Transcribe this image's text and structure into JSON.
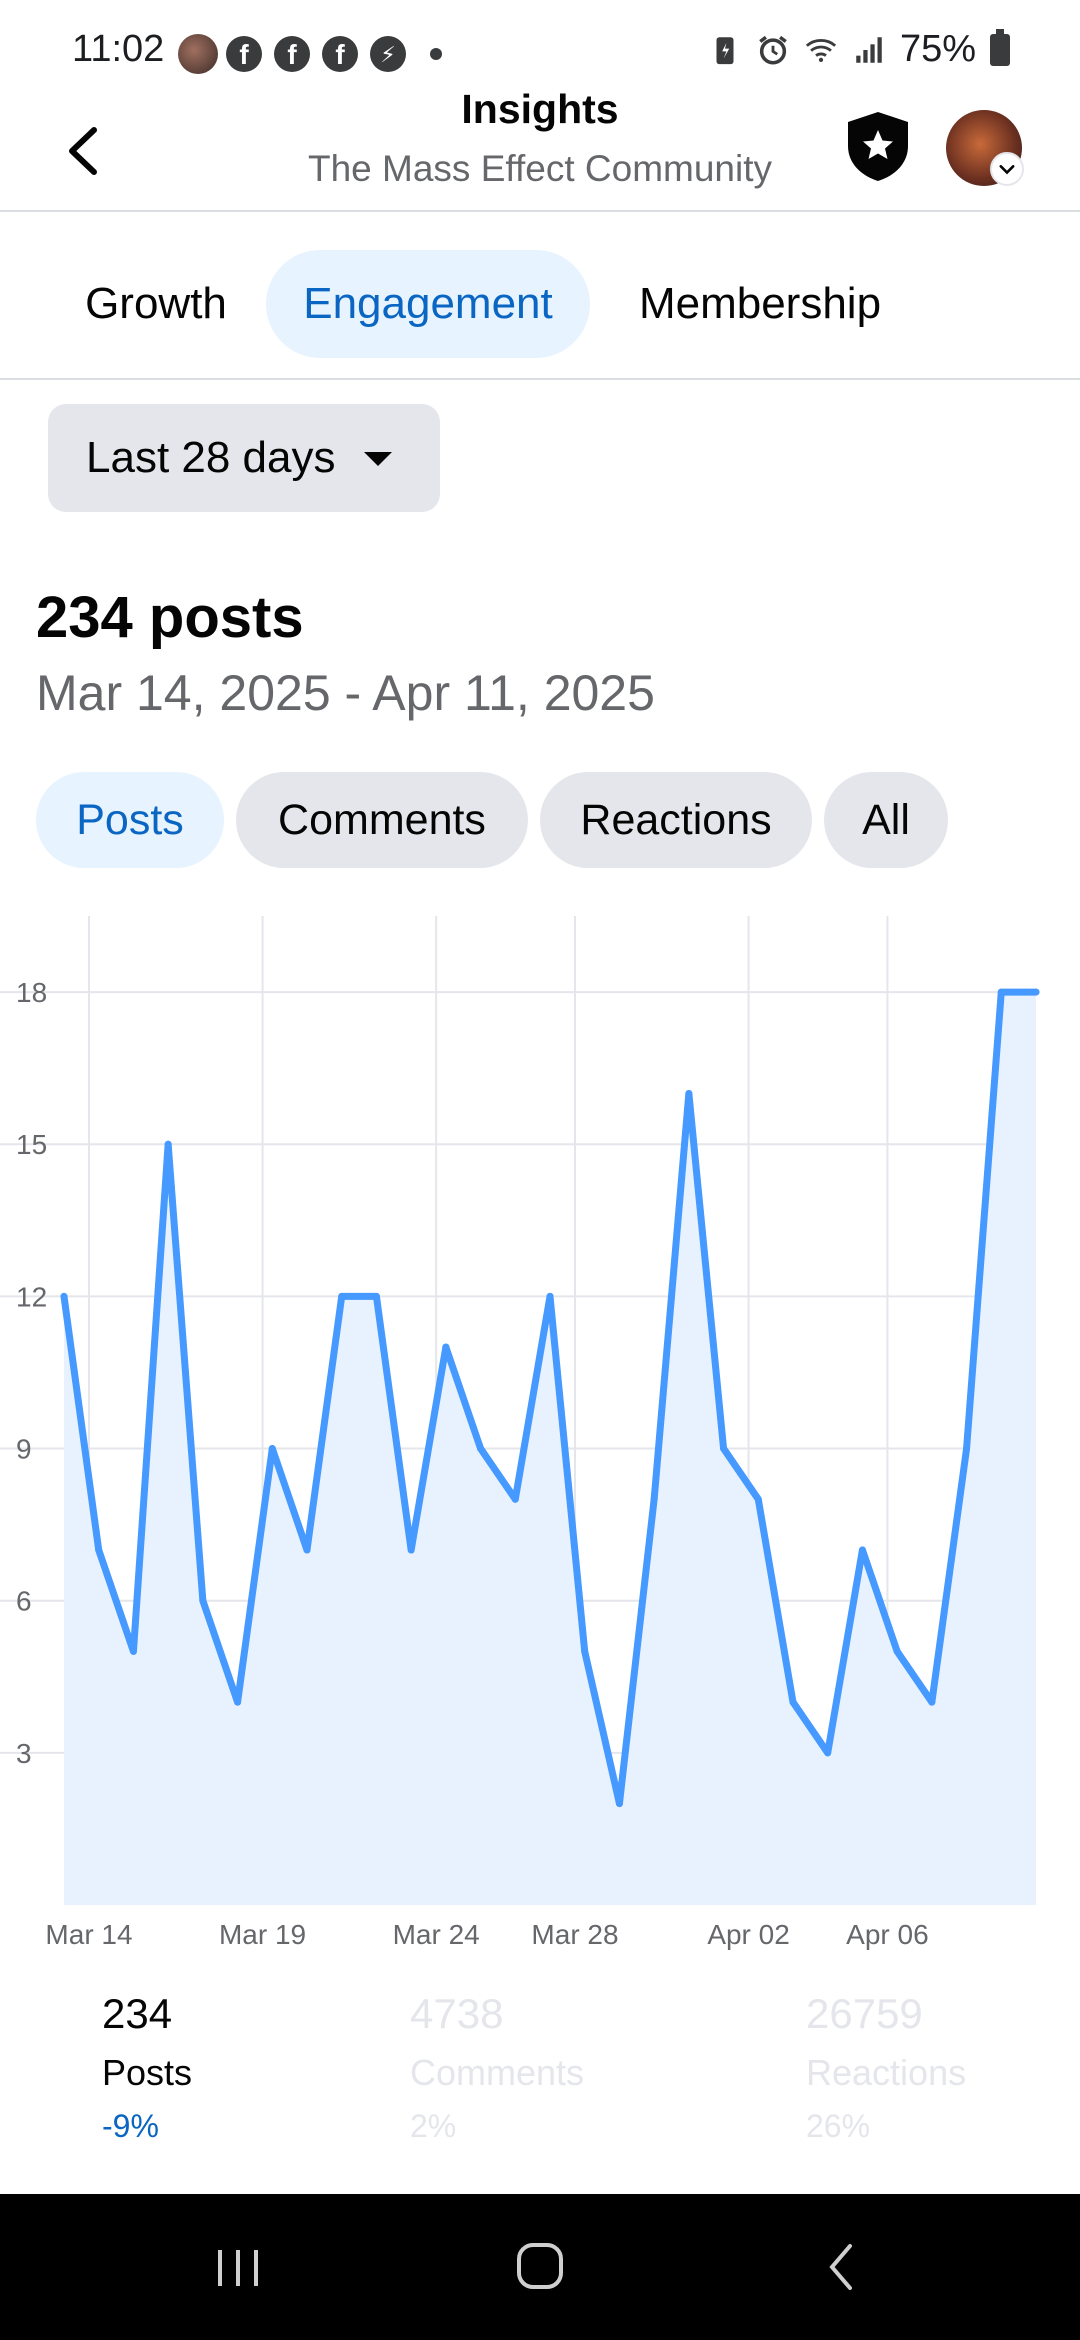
{
  "status_bar": {
    "time": "11:02",
    "battery": "75%",
    "notification_icons": [
      "facebook-icon",
      "facebook-icon",
      "facebook-icon",
      "messenger-icon"
    ]
  },
  "header": {
    "title": "Insights",
    "subtitle": "The Mass Effect Community"
  },
  "tabs": [
    {
      "label": "Growth",
      "active": false
    },
    {
      "label": "Engagement",
      "active": true
    },
    {
      "label": "Membership",
      "active": false
    }
  ],
  "range_selector": {
    "label": "Last 28 days"
  },
  "summary": {
    "title": "234 posts",
    "date_range": "Mar 14, 2025 - Apr 11, 2025"
  },
  "chips": [
    {
      "label": "Posts",
      "active": true
    },
    {
      "label": "Comments",
      "active": false
    },
    {
      "label": "Reactions",
      "active": false
    },
    {
      "label": "All",
      "active": false
    }
  ],
  "chart_data": {
    "type": "area",
    "x": [
      "Mar 14",
      "Mar 15",
      "Mar 16",
      "Mar 17",
      "Mar 18",
      "Mar 19",
      "Mar 20",
      "Mar 21",
      "Mar 22",
      "Mar 23",
      "Mar 24",
      "Mar 25",
      "Mar 26",
      "Mar 27",
      "Mar 28",
      "Mar 29",
      "Mar 30",
      "Mar 31",
      "Apr 01",
      "Apr 02",
      "Apr 03",
      "Apr 04",
      "Apr 05",
      "Apr 06",
      "Apr 07",
      "Apr 08",
      "Apr 09",
      "Apr 10",
      "Apr 11"
    ],
    "series": [
      {
        "values": [
          12,
          7,
          5,
          15,
          6,
          4,
          9,
          7,
          12,
          12,
          7,
          11,
          9,
          8,
          12,
          5,
          2,
          8,
          16,
          9,
          8,
          4,
          3,
          7,
          5,
          4,
          9,
          18,
          18
        ]
      }
    ],
    "x_tick_labels": [
      "Mar 14",
      "Mar 19",
      "Mar 24",
      "Mar 28",
      "Apr 02",
      "Apr 06"
    ],
    "y_ticks": [
      3,
      6,
      9,
      12,
      15,
      18
    ],
    "ylim": [
      0,
      19.5
    ],
    "grid": true,
    "colors": {
      "line": "#4599ff",
      "fill": "#e7f2fe",
      "grid": "#e4e6eb"
    }
  },
  "stats": [
    {
      "value": "234",
      "label": "Posts",
      "change": "-9%",
      "active": true
    },
    {
      "value": "4738",
      "label": "Comments",
      "change": "2%",
      "active": false
    },
    {
      "value": "26759",
      "label": "Reactions",
      "change": "26%",
      "active": false
    }
  ]
}
